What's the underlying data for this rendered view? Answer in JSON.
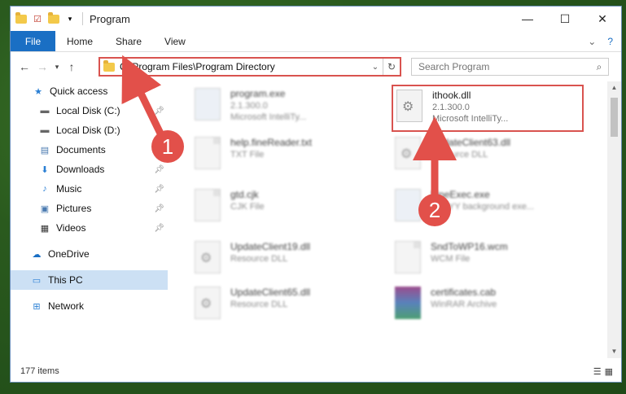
{
  "window": {
    "title": "Program",
    "controls": {
      "minimize": "—",
      "maximize": "☐",
      "close": "✕"
    }
  },
  "ribbon": {
    "tabs": [
      {
        "label": "File",
        "active": true
      },
      {
        "label": "Home"
      },
      {
        "label": "Share"
      },
      {
        "label": "View"
      }
    ]
  },
  "navigation": {
    "address_path": "C:\\Program Files\\Program Directory",
    "search_placeholder": "Search Program"
  },
  "sidebar": {
    "items": [
      {
        "label": "Quick access",
        "icon": "star-icon"
      },
      {
        "label": "Local Disk (C:)",
        "icon": "drive-icon",
        "pinned": true
      },
      {
        "label": "Local Disk (D:)",
        "icon": "drive-icon"
      },
      {
        "label": "Documents",
        "icon": "documents-icon"
      },
      {
        "label": "Downloads",
        "icon": "download-icon",
        "pinned": true
      },
      {
        "label": "Music",
        "icon": "music-icon",
        "pinned": true
      },
      {
        "label": "Pictures",
        "icon": "pictures-icon",
        "pinned": true
      },
      {
        "label": "Videos",
        "icon": "videos-icon",
        "pinned": true
      },
      {
        "label": "OneDrive",
        "icon": "cloud-icon"
      },
      {
        "label": "This PC",
        "icon": "computer-icon",
        "selected": true
      },
      {
        "label": "Network",
        "icon": "network-icon"
      }
    ]
  },
  "files": [
    {
      "name": "program.exe",
      "line1": "2.1.300.0",
      "line2": "Microsoft IntelliTy...",
      "icon": "exe-icon"
    },
    {
      "name": "ithook.dll",
      "line1": "2.1.300.0",
      "line2": "Microsoft IntelliTy...",
      "icon": "dll-icon",
      "highlighted": true
    },
    {
      "name": "help.fineReader.txt",
      "line1": "TXT File",
      "icon": "txt-icon"
    },
    {
      "name": "UpdateClient63.dll",
      "line1": "Resource DLL",
      "icon": "dll-icon"
    },
    {
      "name": "gtd.cjk",
      "line1": "CJK File",
      "icon": "blank-file-icon"
    },
    {
      "name": "FineExec.exe",
      "line1": "ABBYY background exe...",
      "icon": "exe-icon"
    },
    {
      "name": "UpdateClient19.dll",
      "line1": "Resource DLL",
      "icon": "dll-icon"
    },
    {
      "name": "SndToWP16.wcm",
      "line1": "WCM File",
      "icon": "blank-file-icon"
    },
    {
      "name": "UpdateClient65.dll",
      "line1": "Resource DLL",
      "icon": "dll-icon"
    },
    {
      "name": "certificates.cab",
      "line1": "WinRAR Archive",
      "icon": "archive-icon"
    }
  ],
  "status": {
    "item_count": "177 items"
  },
  "annotations": {
    "callout_1": "1",
    "callout_2": "2"
  },
  "colors": {
    "accent": "#1a6fc4",
    "highlight": "#d9534f",
    "callout": "#e2504a"
  }
}
